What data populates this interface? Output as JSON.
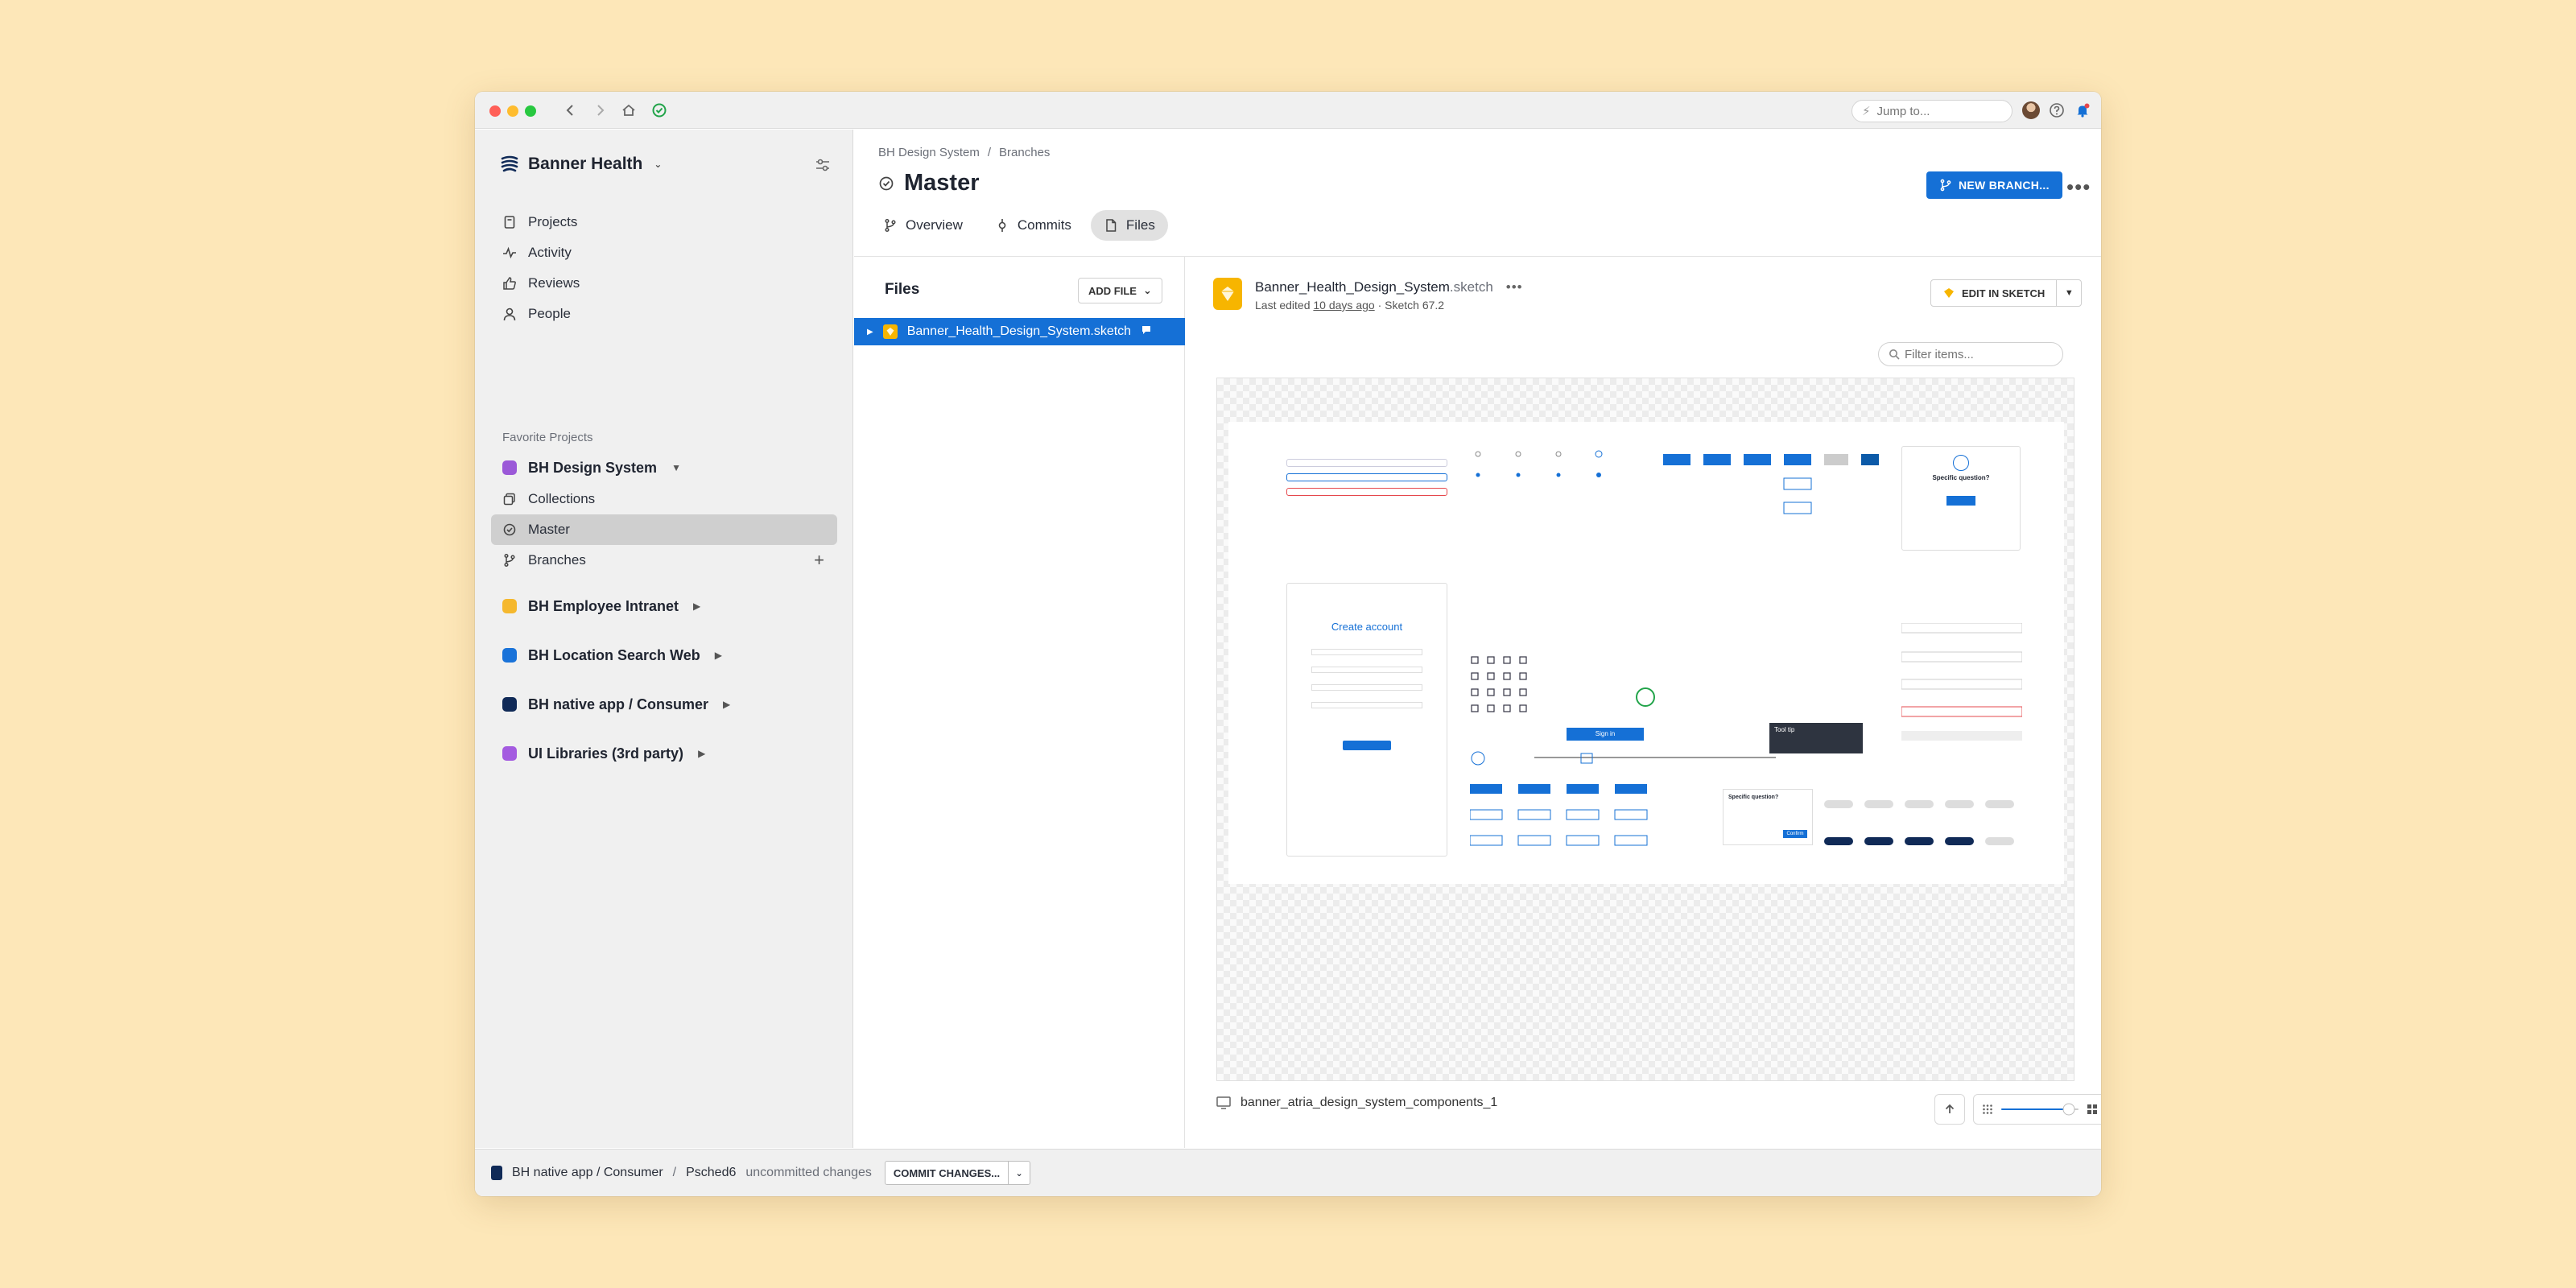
{
  "titlebar": {
    "jump_placeholder": "Jump to..."
  },
  "sidebar": {
    "workspace": "Banner Health",
    "nav": [
      {
        "label": "Projects",
        "icon": "document-icon"
      },
      {
        "label": "Activity",
        "icon": "activity-icon"
      },
      {
        "label": "Reviews",
        "icon": "thumbs-up-icon"
      },
      {
        "label": "People",
        "icon": "person-icon"
      }
    ],
    "favorites_label": "Favorite Projects",
    "favorite_project": {
      "label": "BH Design System",
      "color": "#9b59d8"
    },
    "sub_items": [
      {
        "label": "Collections",
        "icon": "collections-icon"
      },
      {
        "label": "Master",
        "icon": "branch-check-icon",
        "active": true
      },
      {
        "label": "Branches",
        "icon": "branch-icon"
      }
    ],
    "projects": [
      {
        "label": "BH Employee Intranet",
        "color": "#f5b82e"
      },
      {
        "label": "BH Location Search Web",
        "color": "#1a73d9"
      },
      {
        "label": "BH native app / Consumer",
        "color": "#102a57"
      },
      {
        "label": "UI Libraries (3rd party)",
        "color": "#a45be0"
      }
    ]
  },
  "header": {
    "breadcrumb": [
      "BH Design System",
      "/",
      "Branches"
    ],
    "title": "Master",
    "new_branch": "NEW BRANCH...",
    "tabs": [
      {
        "label": "Overview",
        "icon": "overview-icon"
      },
      {
        "label": "Commits",
        "icon": "commit-icon"
      },
      {
        "label": "Files",
        "icon": "file-icon",
        "active": true
      }
    ]
  },
  "files": {
    "title": "Files",
    "add_file": "ADD FILE",
    "selected_file": "Banner_Health_Design_System.sketch"
  },
  "detail": {
    "doc_name": "Banner_Health_Design_System",
    "doc_ext": ".sketch",
    "meta_prefix": "Last edited ",
    "meta_time": "10 days ago",
    "meta_suffix": " · Sketch 67.2",
    "edit_button": "EDIT IN SKETCH",
    "filter_placeholder": "Filter items...",
    "artboard_name": "banner_atria_design_system_components_1",
    "artboard_preview": {
      "create_account": "Create account",
      "sign_in": "Sign in",
      "specific_question": "Specific question?",
      "confirm": "Confirm",
      "tooltip": "Tool tip"
    }
  },
  "bottombar": {
    "project": "BH native app / Consumer",
    "separator": "/",
    "branch": "Psched6",
    "status": "uncommitted changes",
    "commit": "COMMIT CHANGES..."
  },
  "colors": {
    "accent": "#1570d6",
    "background": "#fde7b8"
  }
}
